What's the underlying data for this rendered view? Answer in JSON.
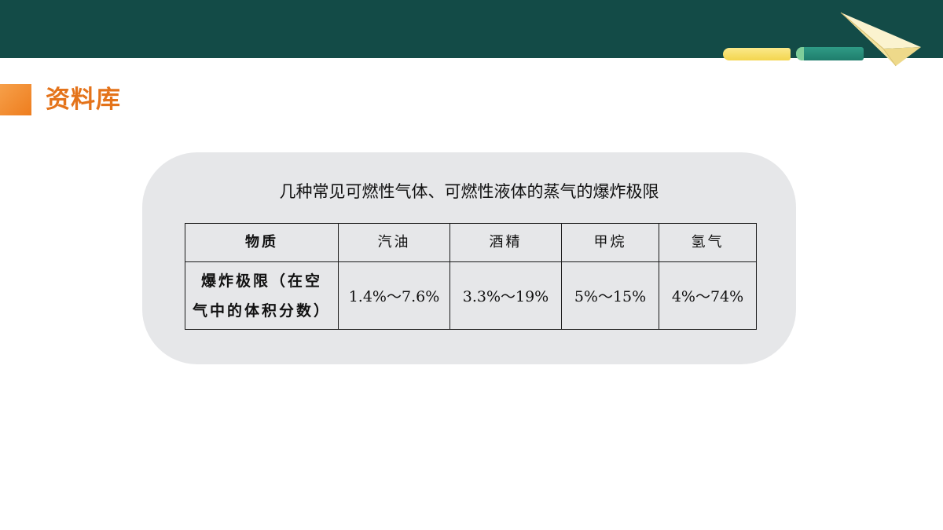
{
  "header": {
    "decor": {
      "chalk_colors": [
        "#f3d54e",
        "#1f7d6c"
      ],
      "icon": "paper-plane-icon"
    }
  },
  "section": {
    "title": "资料库",
    "accent_color": "#e4731a"
  },
  "panel": {
    "caption": "几种常见可燃性气体、可燃性液体的蒸气的爆炸极限",
    "table": {
      "header_label": "物质",
      "columns": [
        "汽油",
        "酒精",
        "甲烷",
        "氢气"
      ],
      "row_label_line1": "爆炸极限（在空",
      "row_label_line2": "气中的体积分数）",
      "values": [
        "1.4%～7.6%",
        "3.3%～19%",
        "5%～15%",
        "4%～74%"
      ]
    }
  }
}
